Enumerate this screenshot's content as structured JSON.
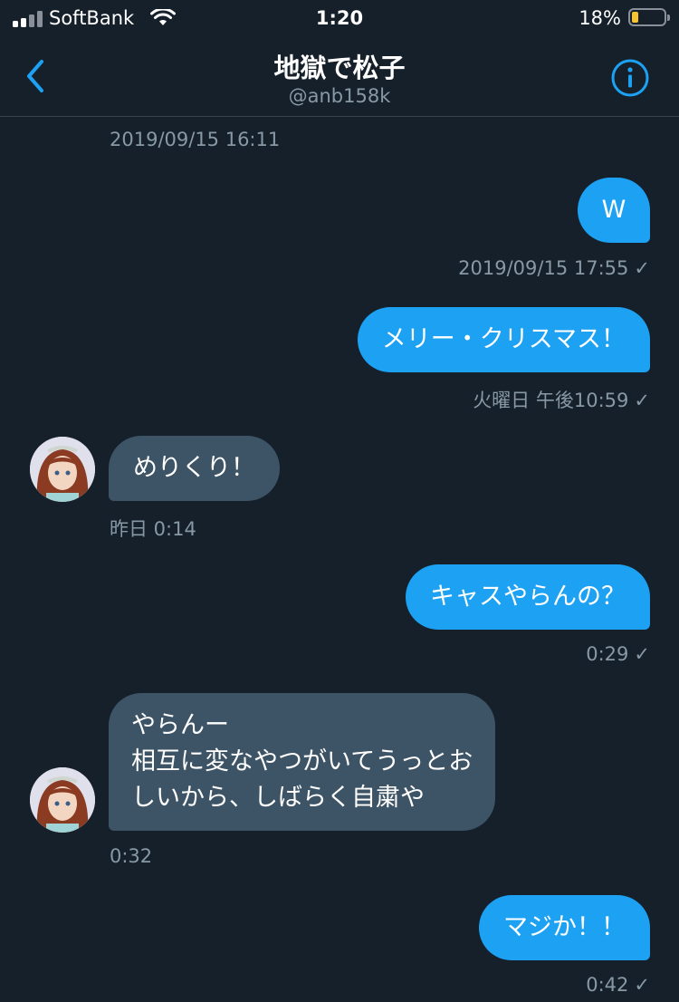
{
  "status_bar": {
    "carrier": "SoftBank",
    "time": "1:20",
    "battery": "18%",
    "battery_level": 0.18,
    "battery_color": "#f7c331"
  },
  "header": {
    "title": "地獄で松子",
    "handle": "@anb158k",
    "back_icon": "chevron-left-icon",
    "info_icon": "info-icon"
  },
  "colors": {
    "background": "#15202b",
    "outgoing_bubble": "#1da1f2",
    "incoming_bubble": "#3d5466",
    "secondary_text": "#8899a6"
  },
  "messages": [
    {
      "direction": "out",
      "text": "W",
      "timestamp": "2019/09/15 17:55",
      "read_check": "✓"
    },
    {
      "direction": "out",
      "text": "メリー・クリスマス！",
      "timestamp": "火曜日 午後10:59",
      "read_check": "✓"
    },
    {
      "direction": "in",
      "text": "めりくり！",
      "timestamp": "昨日 0:14"
    },
    {
      "direction": "out",
      "text": "キャスやらんの？",
      "timestamp": "0:29",
      "read_check": "✓"
    },
    {
      "direction": "in",
      "lines": [
        "やらんー",
        "相互に変なやつがいてうっとお",
        "しいから、しばらく自粛や"
      ],
      "timestamp": "0:32"
    },
    {
      "direction": "out",
      "text": "マジか！！",
      "timestamp": "0:42",
      "read_check": "✓"
    }
  ],
  "top_timestamp": "2019/09/15 16:11"
}
